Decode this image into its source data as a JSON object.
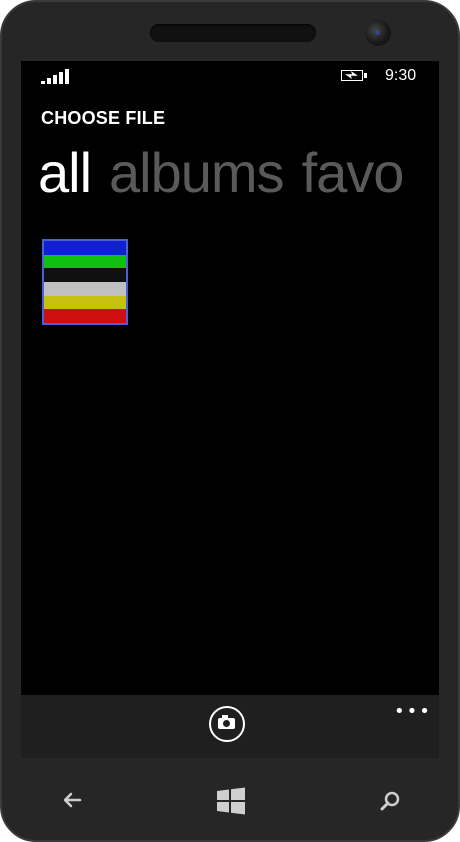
{
  "status_bar": {
    "time": "9:30",
    "signal_icon": "signal-strength-icon",
    "battery_icon": "battery-charging-icon"
  },
  "header": {
    "title": "CHOOSE FILE"
  },
  "pivot": {
    "items": [
      {
        "label": "all",
        "active": true
      },
      {
        "label": "albums",
        "active": false
      },
      {
        "label": "favo",
        "active": false
      }
    ]
  },
  "thumbnail": {
    "icon": "image-thumbnail",
    "stripes": [
      "#1020d0",
      "#10c010",
      "#101010",
      "#c0c0c0",
      "#c8c010",
      "#d01010"
    ],
    "border_color": "#4a5fd8"
  },
  "app_bar": {
    "camera_icon": "camera-icon",
    "more_icon": "more-options-icon",
    "more_label": "•••"
  },
  "hardware_keys": {
    "back_icon": "back-arrow-icon",
    "start_icon": "windows-logo-icon",
    "search_icon": "search-icon"
  }
}
